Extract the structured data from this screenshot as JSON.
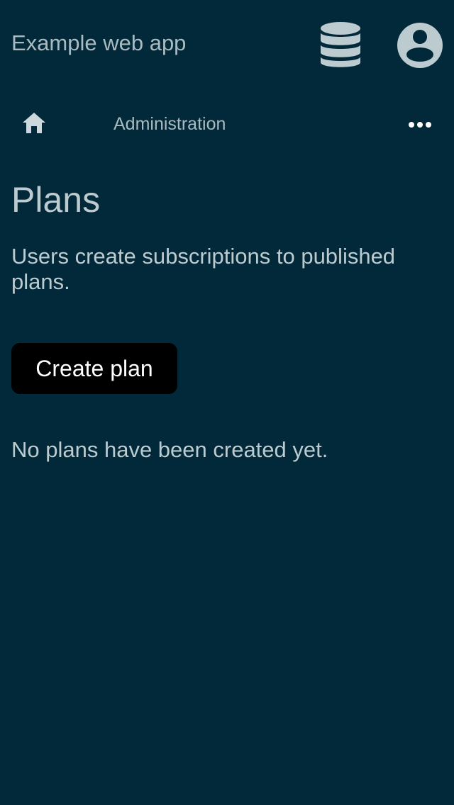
{
  "header": {
    "app_title": "Example web app",
    "database_icon": "database-icon",
    "account_icon": "account-circle-icon"
  },
  "nav": {
    "home_icon": "home-icon",
    "breadcrumb": "Administration",
    "more_icon": "more-horizontal-icon"
  },
  "main": {
    "title": "Plans",
    "description": "Users create subscriptions to published plans.",
    "create_button_label": "Create plan",
    "empty_message": "No plans have been created yet."
  },
  "colors": {
    "background": "#022939",
    "text": "#bccbcf",
    "button_bg": "#000000",
    "button_text": "#ffffff"
  }
}
